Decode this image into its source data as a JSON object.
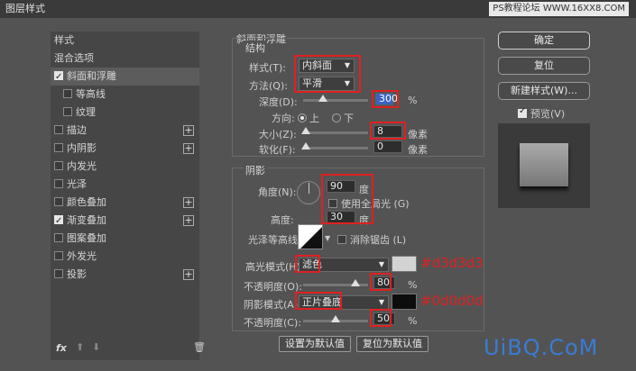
{
  "window": {
    "title": "图层样式"
  },
  "watermark_top": "PS教程论坛 WWW.16XX8.COM",
  "watermark_bottom": "UiBQ.CoM",
  "sidebar": {
    "header": "样式",
    "items": [
      {
        "label": "混合选项",
        "has_checkbox": false
      },
      {
        "label": "斜面和浮雕",
        "checked": true,
        "selected": true
      },
      {
        "label": "等高线",
        "checked": false,
        "indent": true
      },
      {
        "label": "纹理",
        "checked": false,
        "indent": true
      },
      {
        "label": "描边",
        "checked": false,
        "plus": true
      },
      {
        "label": "内阴影",
        "checked": false,
        "plus": true
      },
      {
        "label": "内发光",
        "checked": false
      },
      {
        "label": "光泽",
        "checked": false
      },
      {
        "label": "颜色叠加",
        "checked": false,
        "plus": true
      },
      {
        "label": "渐变叠加",
        "checked": true,
        "plus": true
      },
      {
        "label": "图案叠加",
        "checked": false
      },
      {
        "label": "外发光",
        "checked": false
      },
      {
        "label": "投影",
        "checked": false,
        "plus": true
      }
    ],
    "footer_fx": "fx"
  },
  "bevel": {
    "section_title": "斜面和浮雕",
    "structure_title": "结构",
    "style_label": "样式(T):",
    "style_value": "内斜面",
    "technique_label": "方法(Q):",
    "technique_value": "平滑",
    "depth_label": "深度(D):",
    "depth_value": "300",
    "depth_unit": "%",
    "depth_fraction": 0.3,
    "direction_label": "方向:",
    "direction_up": "上",
    "direction_down": "下",
    "size_label": "大小(Z):",
    "size_value": "8",
    "size_unit": "像素",
    "soften_label": "软化(F):",
    "soften_value": "0",
    "soften_unit": "像素"
  },
  "shading": {
    "title": "阴影",
    "angle_label": "角度(N):",
    "angle_value": "90",
    "angle_unit": "度",
    "global_light_label": "使用全局光 (G)",
    "altitude_label": "高度:",
    "altitude_value": "30",
    "altitude_unit": "度",
    "gloss_label": "光泽等高线:",
    "antialias_label": "消除锯齿 (L)",
    "highlight_mode_label": "高光模式(H):",
    "highlight_mode_value": "滤色",
    "highlight_color": "#d3d3d3",
    "highlight_hex_text": "#d3d3d3",
    "highlight_opacity_label": "不透明度(O):",
    "highlight_opacity_value": "80",
    "highlight_opacity_fraction": 0.8,
    "shadow_mode_label": "阴影模式(A):",
    "shadow_mode_value": "正片叠底",
    "shadow_color": "#0d0d0d",
    "shadow_hex_text": "#0d0d0d",
    "shadow_opacity_label": "不透明度(C):",
    "shadow_opacity_value": "50",
    "shadow_opacity_fraction": 0.5,
    "percent": "%"
  },
  "footer": {
    "set_default": "设置为默认值",
    "reset_default": "复位为默认值"
  },
  "right": {
    "ok": "确定",
    "reset": "复位",
    "new_style": "新建样式(W)...",
    "preview_label": "预览(V)",
    "preview_checked": true
  },
  "colors": {
    "annotation_red": "#e02020",
    "selection_blue": "#3b63c4"
  }
}
